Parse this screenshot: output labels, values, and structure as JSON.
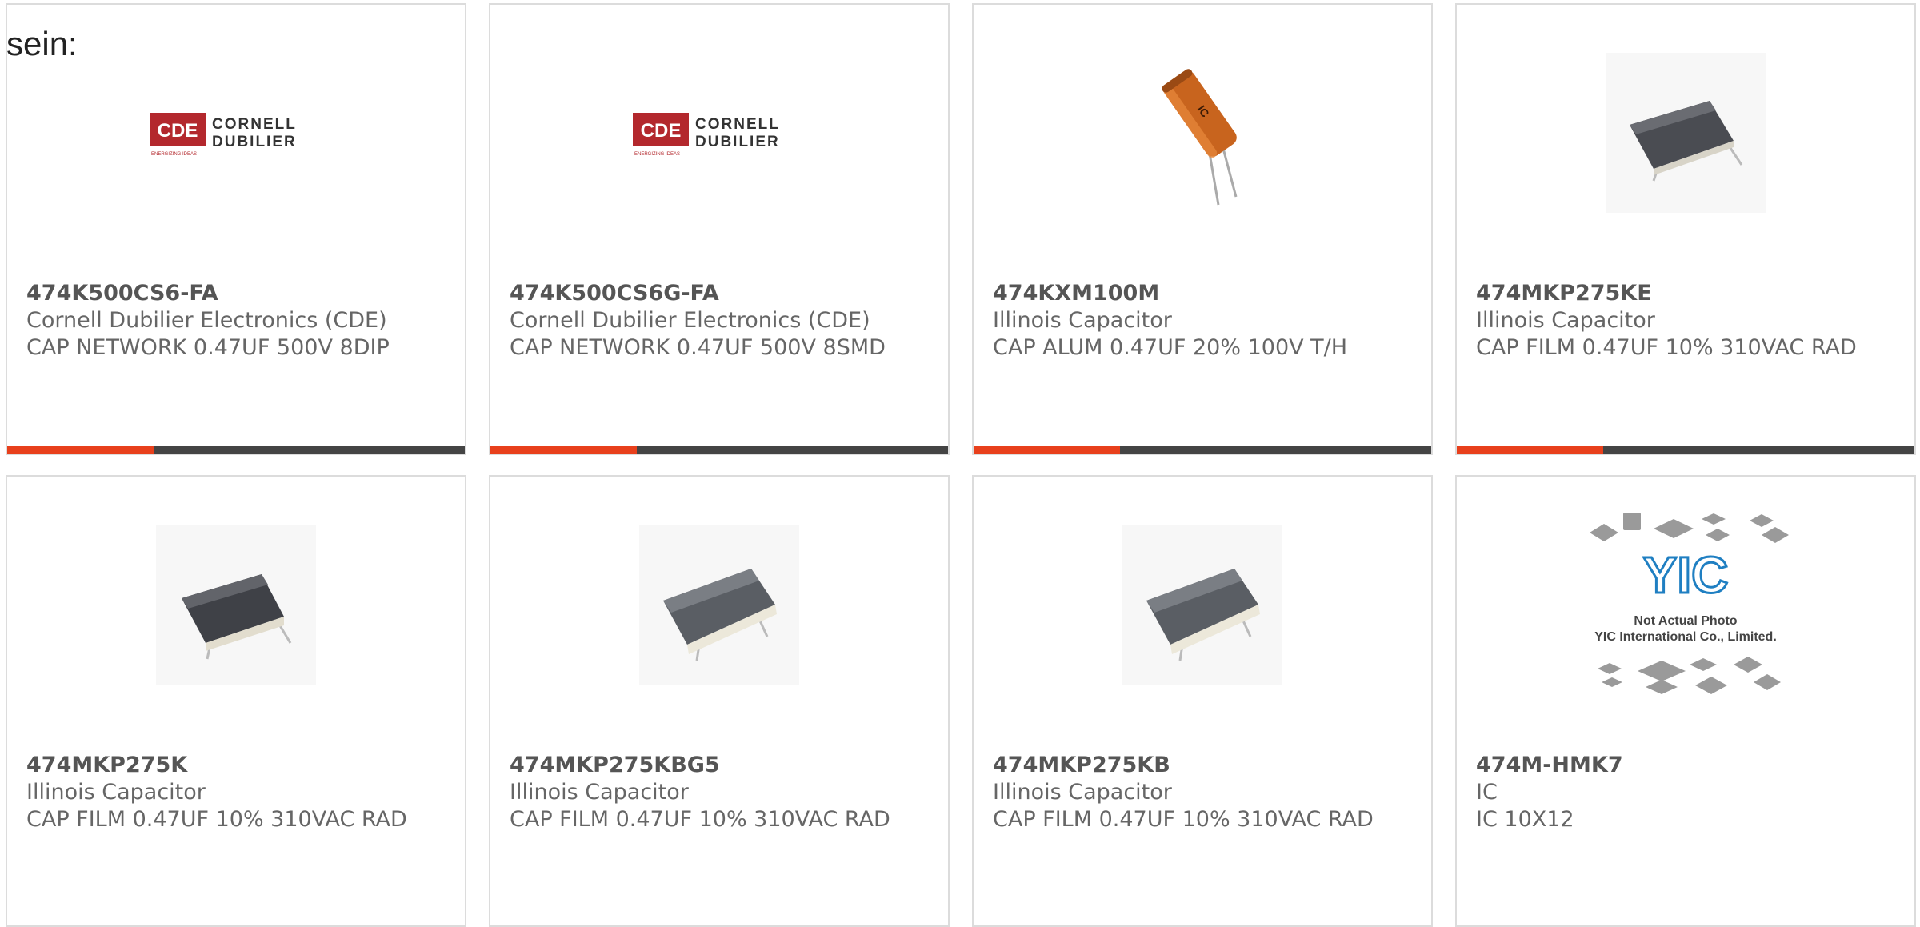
{
  "intro_text": "sein:",
  "accent_color": "#e8401c",
  "bar_color": "#444444",
  "products": [
    {
      "part_number": "474K500CS6-FA",
      "manufacturer": "Cornell Dubilier Electronics (CDE)",
      "description": "CAP NETWORK 0.47UF 500V 8DIP",
      "image": "cde-logo",
      "logo_line1": "CORNELL",
      "logo_line2": "DUBILIER",
      "logo_mark": "CDE",
      "logo_tag": "ENERGIZING IDEAS"
    },
    {
      "part_number": "474K500CS6G-FA",
      "manufacturer": "Cornell Dubilier Electronics (CDE)",
      "description": "CAP NETWORK 0.47UF 500V 8SMD",
      "image": "cde-logo",
      "logo_line1": "CORNELL",
      "logo_line2": "DUBILIER",
      "logo_mark": "CDE",
      "logo_tag": "ENERGIZING IDEAS"
    },
    {
      "part_number": "474KXM100M",
      "manufacturer": "Illinois Capacitor",
      "description": "CAP ALUM 0.47UF 20% 100V T/H",
      "image": "electrolytic-capacitor-photo"
    },
    {
      "part_number": "474MKP275KE",
      "manufacturer": "Illinois Capacitor",
      "description": "CAP FILM 0.47UF 10% 310VAC RAD",
      "image": "film-capacitor-photo"
    },
    {
      "part_number": "474MKP275K",
      "manufacturer": "Illinois Capacitor",
      "description": "CAP FILM 0.47UF 10% 310VAC RAD",
      "image": "film-capacitor-photo"
    },
    {
      "part_number": "474MKP275KBG5",
      "manufacturer": "Illinois Capacitor",
      "description": "CAP FILM 0.47UF 10% 310VAC RAD",
      "image": "film-capacitor-flat-photo"
    },
    {
      "part_number": "474MKP275KB",
      "manufacturer": "Illinois Capacitor",
      "description": "CAP FILM 0.47UF 10% 310VAC RAD",
      "image": "film-capacitor-flat-photo"
    },
    {
      "part_number": "474M-HMK7",
      "manufacturer": "IC",
      "description": "IC 10X12",
      "image": "yic-placeholder",
      "placeholder_line1": "Not Actual Photo",
      "placeholder_line2": "YIC International Co., Limited."
    }
  ]
}
